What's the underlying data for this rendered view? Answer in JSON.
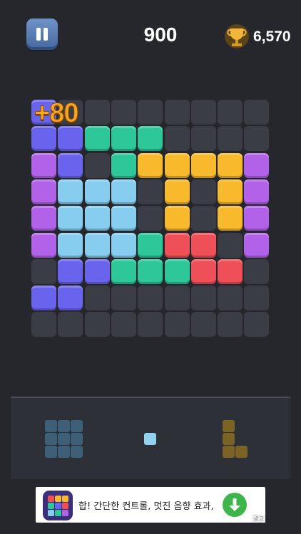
{
  "hud": {
    "score": "900",
    "best_score": "6,570",
    "pause_icon": "pause-icon",
    "trophy_icon": "trophy-icon"
  },
  "floating_score": "+80",
  "board": {
    "size": 9,
    "colors": {
      "B": "#6a63ee",
      "G": "#2ec79a",
      "Y": "#f8b92c",
      "P": "#b262e8",
      "L": "#86cdef",
      "R": "#ef4f57"
    },
    "rows": [
      "B........",
      "BBGGG....",
      "PB.GYYYYP",
      "PLLL.Y.YP",
      "PLLL.Y.YP",
      "PLLLGRR.P",
      ".BBGGGRR.",
      "BB.......",
      "........."
    ]
  },
  "tray": {
    "pieces": [
      {
        "name": "square-3x3",
        "color": "#3d5f77",
        "cells": [
          [
            0,
            0
          ],
          [
            0,
            1
          ],
          [
            0,
            2
          ],
          [
            1,
            0
          ],
          [
            1,
            1
          ],
          [
            1,
            2
          ],
          [
            2,
            0
          ],
          [
            2,
            1
          ],
          [
            2,
            2
          ]
        ]
      },
      {
        "name": "single",
        "color": "#8fd3ef",
        "cells": [
          [
            0,
            0
          ]
        ]
      },
      {
        "name": "l-shape",
        "color": "#7a6324",
        "cells": [
          [
            0,
            0
          ],
          [
            1,
            0
          ],
          [
            2,
            0
          ],
          [
            2,
            1
          ]
        ]
      }
    ]
  },
  "ad": {
    "text": "합! 간단한 컨트롤, 멋진 음향 효과,",
    "download_icon": "download-icon",
    "badge": "광고"
  }
}
